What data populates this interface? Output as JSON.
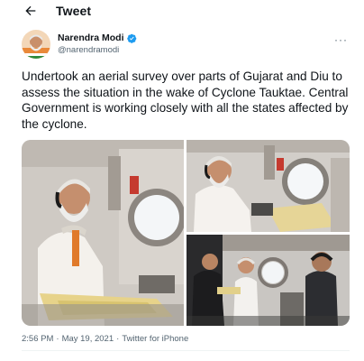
{
  "topbar": {
    "title": "Tweet",
    "back_icon": "arrow-left-icon"
  },
  "author": {
    "name": "Narendra Modi",
    "handle": "@narendramodi",
    "verified": true,
    "verified_color": "#1d9bf0"
  },
  "more_label": "···",
  "tweet": {
    "text": "Undertook an aerial survey over parts of Gujarat and Diu to assess the situation in the wake of Cyclone Tauktae. Central Government is working closely with all the states affected by the cyclone."
  },
  "media": {
    "count": 3
  },
  "meta": {
    "time": "2:56 PM",
    "sep1": "·",
    "date": "May 19, 2021",
    "sep2": "·",
    "source": "Twitter for iPhone"
  },
  "colors": {
    "text": "#0f1419",
    "secondary": "#536471",
    "accent": "#1d9bf0"
  }
}
